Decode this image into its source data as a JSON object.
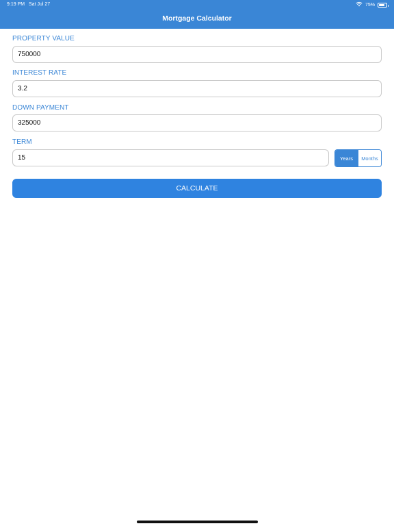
{
  "status_bar": {
    "time": "9:19 PM",
    "date": "Sat Jul 27",
    "battery_percent": "75%",
    "battery_level": 0.75,
    "wifi_icon": "wifi-icon",
    "battery_icon": "battery-icon"
  },
  "nav": {
    "title": "Mortgage Calculator"
  },
  "form": {
    "property_value": {
      "label": "PROPERTY VALUE",
      "value": "750000"
    },
    "interest_rate": {
      "label": "INTEREST RATE",
      "value": "3.2"
    },
    "down_payment": {
      "label": "DOWN PAYMENT",
      "value": "325000"
    },
    "term": {
      "label": "TERM",
      "value": "15",
      "units": [
        "Years",
        "Months"
      ],
      "selected_unit": "Years"
    }
  },
  "calculate_label": "CALCULATE",
  "colors": {
    "accent": "#3a86d6",
    "button": "#2f83e0"
  }
}
